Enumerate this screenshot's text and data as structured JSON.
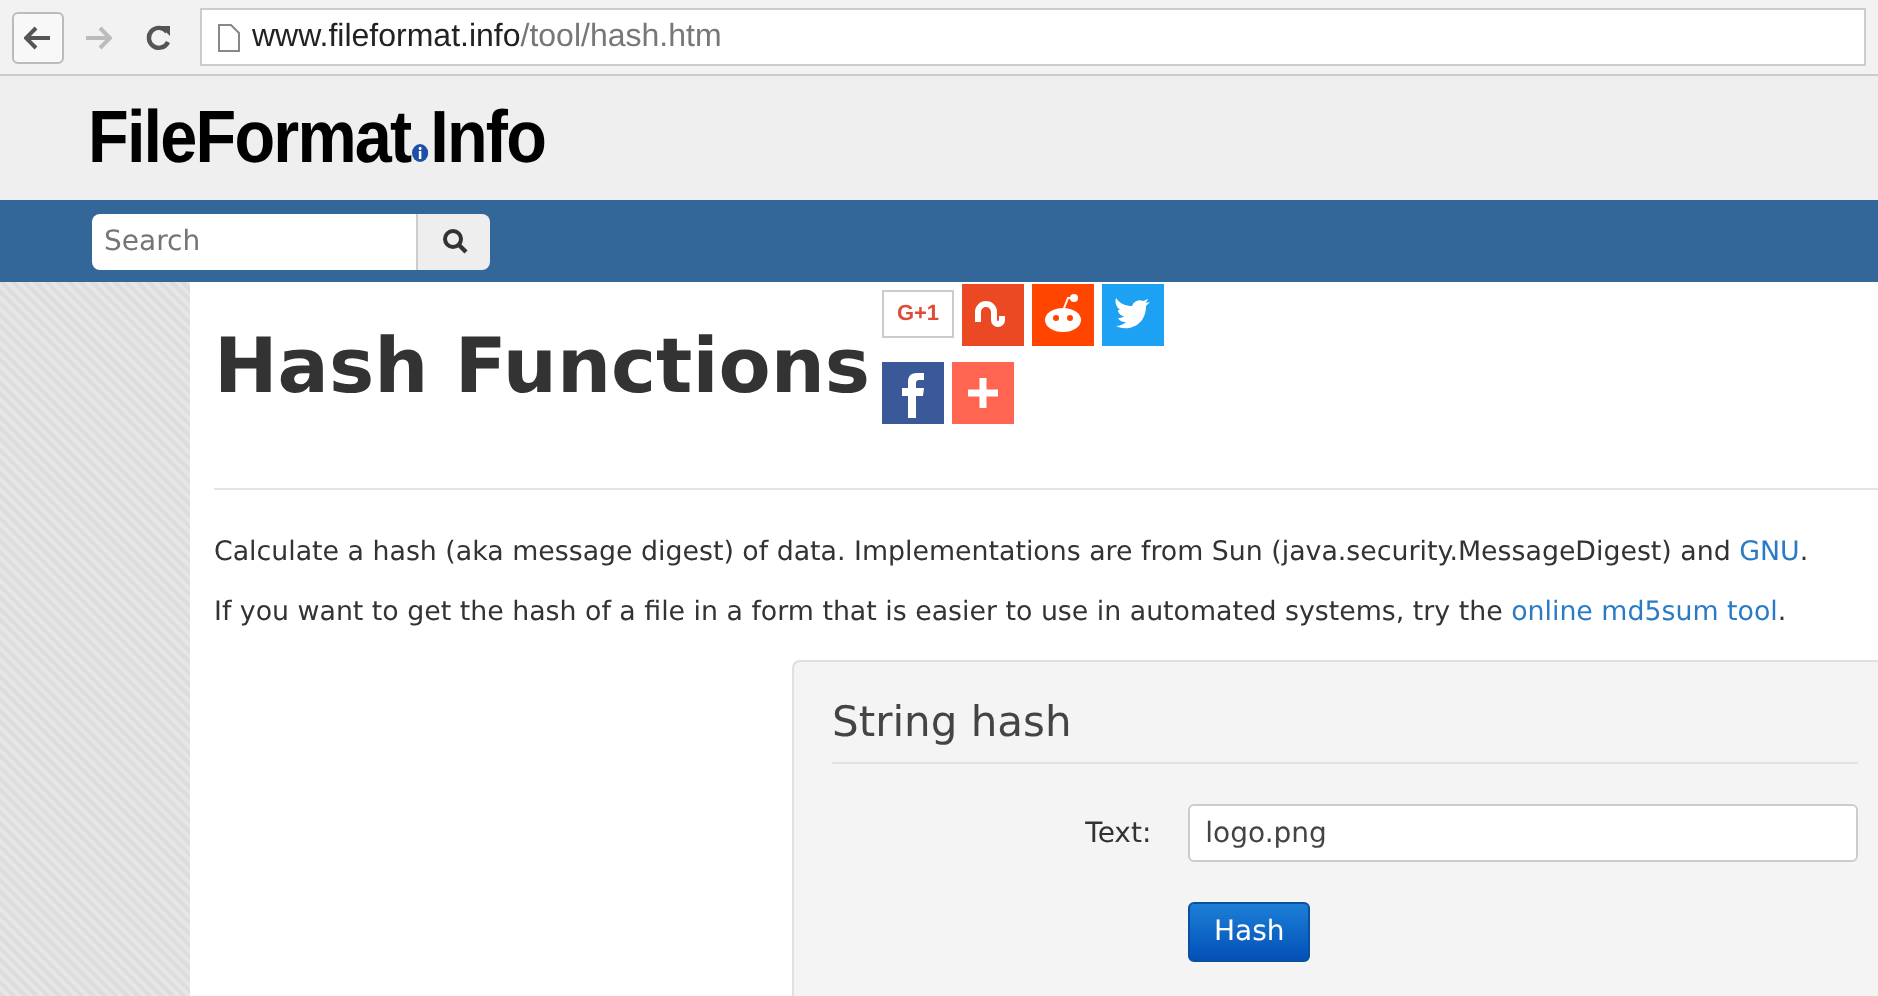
{
  "browser": {
    "url_host": "www.fileformat.info",
    "url_path": "/tool/hash.htm"
  },
  "header": {
    "logo_left": "FileFormat",
    "logo_right": "Info"
  },
  "search": {
    "placeholder": "Search"
  },
  "page": {
    "title": "Hash Functions",
    "share_label": "G+1",
    "paragraphs": [
      {
        "before": "Calculate a hash (aka message digest) of data. Implementations are from Sun (java.security.MessageDigest) and ",
        "link": "GNU",
        "after": "."
      },
      {
        "before": "If you want to get the hash of a file in a form that is easier to use in automated systems, try the ",
        "link": "online md5sum tool",
        "after": "."
      }
    ]
  },
  "form": {
    "title": "String hash",
    "label": "Text:",
    "value": "logo.png",
    "button": "Hash"
  }
}
